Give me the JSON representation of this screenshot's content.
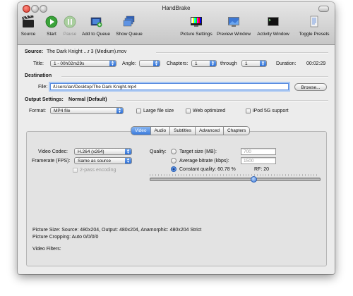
{
  "window": {
    "title": "HandBrake"
  },
  "toolbar": {
    "source": "Source",
    "start": "Start",
    "pause": "Pause",
    "add_to_queue": "Add to Queue",
    "show_queue": "Show Queue",
    "picture_settings": "Picture Settings",
    "preview_window": "Preview Window",
    "activity_window": "Activity Window",
    "toggle_presets": "Toggle Presets"
  },
  "source": {
    "label": "Source:",
    "value": "The Dark Knight ...r 3 (Medium).mov",
    "title_label": "Title:",
    "title_value": "1 - 00h02m29s",
    "angle_label": "Angle:",
    "angle_value": "",
    "chapters_label": "Chapters:",
    "chapter_from": "1",
    "through_label": "through",
    "chapter_to": "1",
    "duration_label": "Duration:",
    "duration_value": "00:02:29"
  },
  "destination": {
    "label": "Destination",
    "file_label": "File:",
    "file_value": "/Users/ian/Desktop/The Dark Knight.mp4",
    "browse": "Browse..."
  },
  "output": {
    "label": "Output Settings:",
    "preset": "Normal (Default)",
    "format_label": "Format:",
    "format_value": "MP4 file",
    "large_file": "Large file size",
    "web_optimized": "Web optimized",
    "ipod_5g": "iPod 5G support"
  },
  "tabs": [
    "Video",
    "Audio",
    "Subtitles",
    "Advanced",
    "Chapters"
  ],
  "video": {
    "codec_label": "Video Codec:",
    "codec_value": "H.264 (x264)",
    "framerate_label": "Framerate (FPS):",
    "framerate_value": "Same as source",
    "two_pass": "2-pass encoding",
    "quality_label": "Quality:",
    "target_size_label": "Target size (MB):",
    "target_size_value": "700",
    "avg_bitrate_label": "Average bitrate (kbps):",
    "avg_bitrate_value": "1500",
    "constant_quality_label": "Constant quality: 60.78 %",
    "rf_label": "RF: 20",
    "quality_fraction": 0.6078
  },
  "info": {
    "picture_size": "Picture Size: Source: 480x204, Output: 480x204, Anamorphic: 480x204 Strict",
    "picture_cropping": "Picture Cropping: Auto 0/0/0/0",
    "video_filters": "Video Filters:"
  }
}
